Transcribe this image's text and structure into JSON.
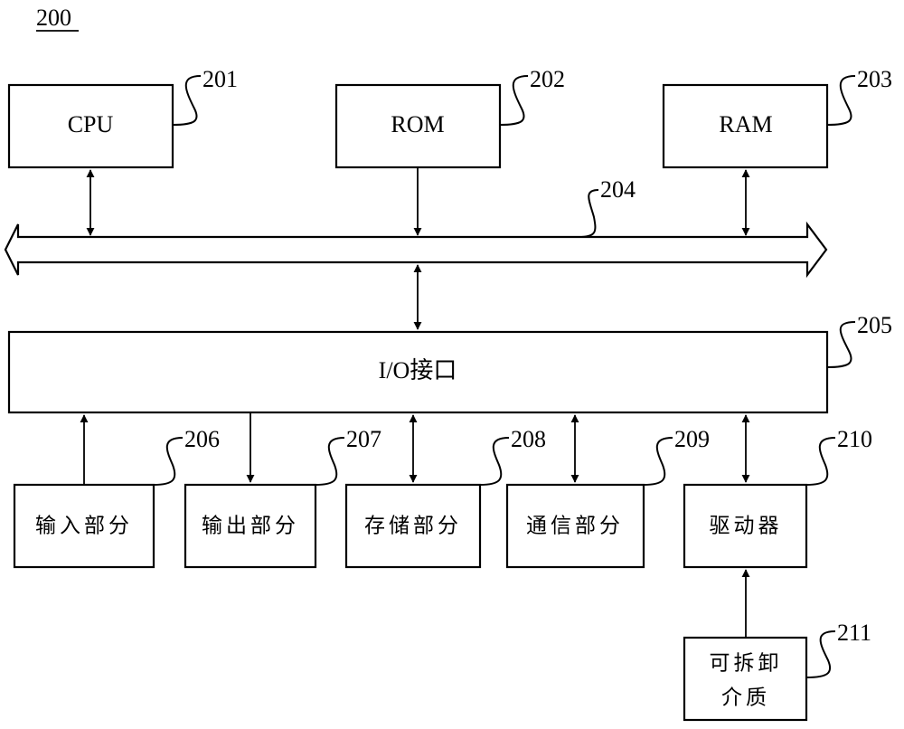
{
  "figure": {
    "number": "200",
    "blocks": {
      "cpu": {
        "label": "CPU",
        "ref": "201"
      },
      "rom": {
        "label": "ROM",
        "ref": "202"
      },
      "ram": {
        "label": "RAM",
        "ref": "203"
      },
      "bus": {
        "ref": "204"
      },
      "io": {
        "label": "I/O接口",
        "ref": "205"
      },
      "input": {
        "label": "输入部分",
        "ref": "206"
      },
      "output": {
        "label": "输出部分",
        "ref": "207"
      },
      "storage": {
        "label": "存储部分",
        "ref": "208"
      },
      "comm": {
        "label": "通信部分",
        "ref": "209"
      },
      "driver": {
        "label": "驱动器",
        "ref": "210"
      },
      "media": {
        "label_line1": "可拆卸",
        "label_line2": "介质",
        "ref": "211"
      }
    }
  }
}
